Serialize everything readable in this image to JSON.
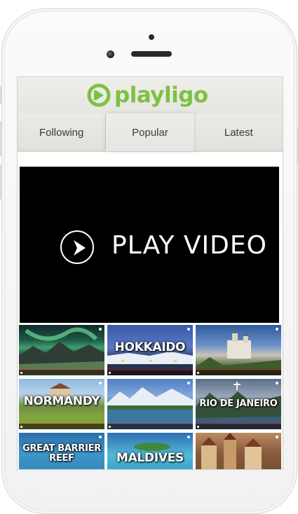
{
  "app": {
    "brand": "playligo",
    "brand_color": "#7dc143"
  },
  "tabs": [
    {
      "label": "Following",
      "active": false
    },
    {
      "label": "Popular",
      "active": true
    },
    {
      "label": "Latest",
      "active": false
    }
  ],
  "player": {
    "label": "PLAY VIDEO",
    "icon": "play-circle-icon"
  },
  "thumbnails": [
    {
      "caption": "",
      "scene": "aurora"
    },
    {
      "caption": "HOKKAIDO",
      "scene": "snowy-harbor"
    },
    {
      "caption": "",
      "scene": "castle"
    },
    {
      "caption": "NORMANDY",
      "scene": "village-field"
    },
    {
      "caption": "",
      "scene": "lake-mountains"
    },
    {
      "caption": "RIO DE JANEIRO",
      "scene": "bay-city"
    },
    {
      "caption": "GREAT BARRIER REEF",
      "scene": "reef"
    },
    {
      "caption": "MALDIVES",
      "scene": "island"
    },
    {
      "caption": "",
      "scene": "old-town"
    }
  ]
}
